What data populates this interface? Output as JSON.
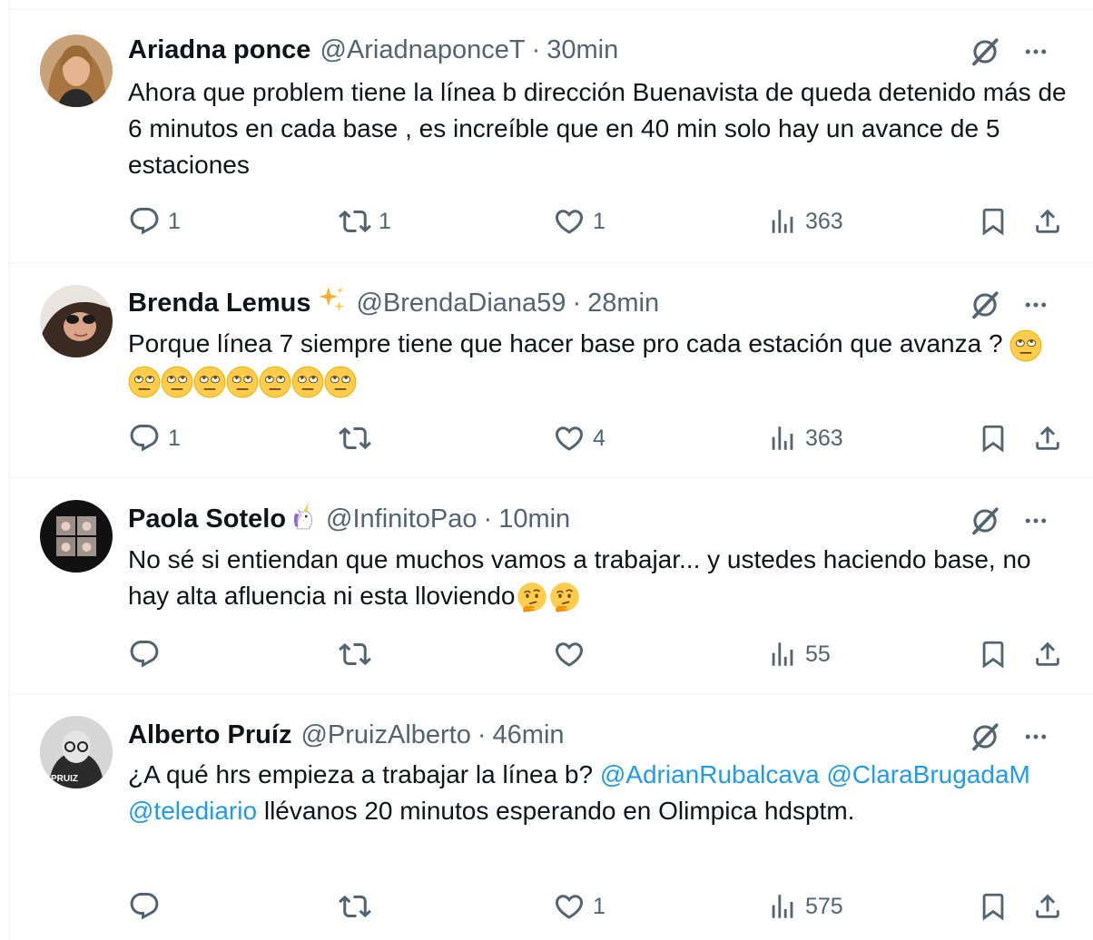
{
  "tweets": [
    {
      "name": "Ariadna ponce",
      "handle": "@AriadnaponceT",
      "separator": "·",
      "time": "30min",
      "text": "Ahora que problem tiene la línea b dirección Buenavista de queda detenido más de 6 minutos en cada base , es increíble que en 40 min solo hay un avance de 5 estaciones",
      "replies": "1",
      "retweets": "1",
      "likes": "1",
      "views": "363"
    },
    {
      "name": "Brenda Lemus",
      "name_emoji": "sparkles-emoji",
      "handle": "@BrendaDiana59",
      "separator": "·",
      "time": "28min",
      "text": "Porque línea 7 siempre tiene que hacer base pro cada estación que avanza ?",
      "text_emoji": "face-with-rolling-eyes-emoji",
      "text_emoji_count": 8,
      "replies": "1",
      "retweets": "",
      "likes": "4",
      "views": "363"
    },
    {
      "name": "Paola Sotelo",
      "name_emoji": "unicorn-emoji",
      "handle": "@InfinitoPao",
      "separator": "·",
      "time": "10min",
      "text": "No sé si entiendan que muchos vamos a trabajar... y ustedes haciendo base, no hay alta afluencia ni esta lloviendo",
      "text_emoji": "thinking-face-emoji",
      "text_emoji_count": 2,
      "replies": "",
      "retweets": "",
      "likes": "",
      "views": "55"
    },
    {
      "name": "Alberto Pruíz",
      "handle": "@PruizAlberto",
      "separator": "·",
      "time": "46min",
      "text_before": "¿A qué hrs empieza a trabajar la línea b?",
      "mention1": "@AdrianRubalcava",
      "mention2": "@ClaraBrugadaM",
      "mention3": "@telediario",
      "text_after": "llévanos 20 minutos esperando en Olimpica hdsptm.",
      "avatar_text": "PRUIZ",
      "replies": "",
      "retweets": "",
      "likes": "1",
      "views": "575"
    }
  ],
  "colors": {
    "text": "#0f1419",
    "secondary": "#536471",
    "link": "#1d9bf0",
    "divider": "#eff3f4"
  },
  "icons": [
    "reply-icon",
    "retweet-icon",
    "like-icon",
    "views-icon",
    "bookmark-icon",
    "share-icon",
    "grok-icon",
    "more-icon"
  ]
}
